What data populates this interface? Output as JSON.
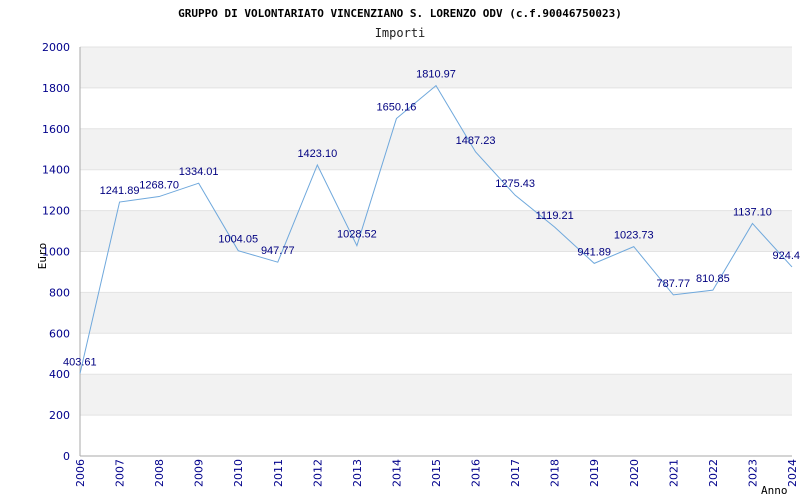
{
  "chart_data": {
    "type": "line",
    "title": "GRUPPO DI VOLONTARIATO VINCENZIANO S. LORENZO ODV (c.f.90046750023)",
    "subtitle": "Importi",
    "xlabel": "Anno",
    "ylabel": "Euro",
    "x": [
      2006,
      2007,
      2008,
      2009,
      2010,
      2011,
      2012,
      2013,
      2014,
      2015,
      2016,
      2017,
      2018,
      2019,
      2020,
      2021,
      2022,
      2023,
      2024
    ],
    "x_tick_labels": [
      "2006",
      "2007",
      "2008",
      "2009",
      "2010",
      "2011",
      "2012",
      "2013",
      "2014",
      "2015",
      "2016",
      "2017",
      "2018",
      "2019",
      "2020",
      "2021",
      "2022",
      "2023",
      "2024"
    ],
    "values": [
      403.61,
      1241.89,
      1268.7,
      1334.01,
      1004.05,
      947.77,
      1423.1,
      1028.52,
      1650.16,
      1810.97,
      1487.23,
      1275.43,
      1119.21,
      941.89,
      1023.73,
      787.77,
      810.85,
      1137.1,
      924.4
    ],
    "value_labels": [
      "403.61",
      "1241.89",
      "1268.70",
      "1334.01",
      "1004.05",
      "947.77",
      "1423.10",
      "1028.52",
      "1650.16",
      "1810.97",
      "1487.23",
      "1275.43",
      "1119.21",
      "941.89",
      "1023.73",
      "787.77",
      "810.85",
      "1137.10",
      "924.4"
    ],
    "y_ticks": [
      0,
      200,
      400,
      600,
      800,
      1000,
      1200,
      1400,
      1600,
      1800,
      2000
    ],
    "y_tick_labels": [
      "0",
      "200",
      "400",
      "600",
      "800",
      "1000",
      "1200",
      "1400",
      "1600",
      "1800",
      "2000"
    ],
    "ylim": [
      0,
      2000
    ],
    "xlim": [
      2006,
      2024
    ],
    "grid": true,
    "line_color": "#6fa8dc",
    "band_color": "#f2f2f2",
    "tick_color": "#00008b",
    "label_color": "#000080"
  }
}
